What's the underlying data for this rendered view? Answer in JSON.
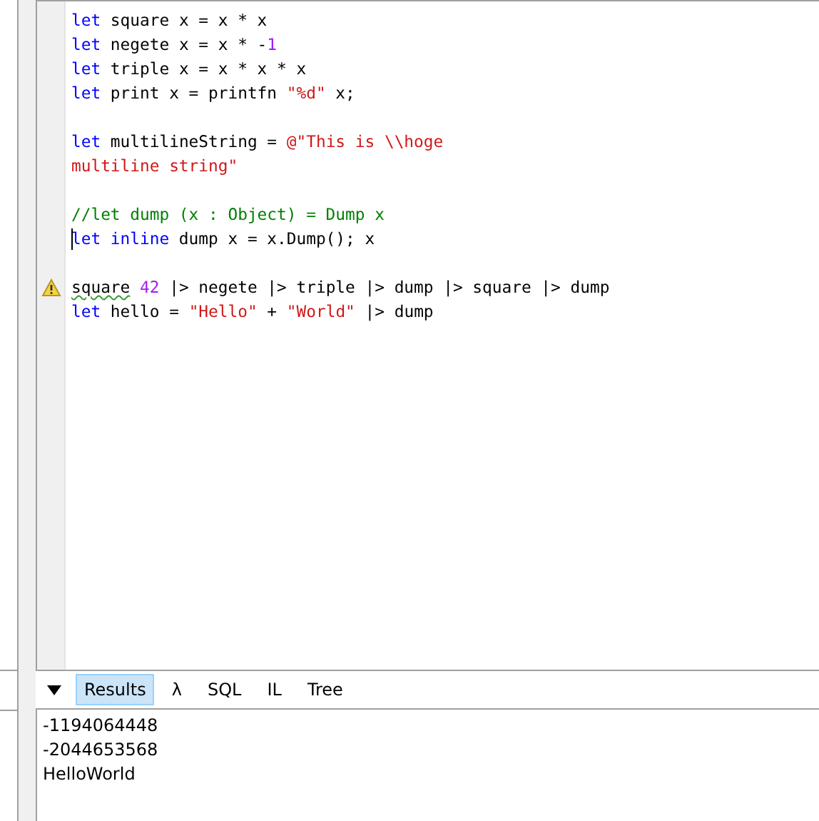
{
  "editor": {
    "lines": [
      {
        "tokens": [
          {
            "kind": "keyword",
            "text": "let"
          },
          {
            "kind": "plain",
            "text": " square x = x * x"
          }
        ]
      },
      {
        "tokens": [
          {
            "kind": "keyword",
            "text": "let"
          },
          {
            "kind": "plain",
            "text": " negete x = x * -"
          },
          {
            "kind": "number",
            "text": "1"
          }
        ]
      },
      {
        "tokens": [
          {
            "kind": "keyword",
            "text": "let"
          },
          {
            "kind": "plain",
            "text": " triple x = x * x * x"
          }
        ]
      },
      {
        "tokens": [
          {
            "kind": "keyword",
            "text": "let"
          },
          {
            "kind": "plain",
            "text": " print x = printfn "
          },
          {
            "kind": "string",
            "text": "\"%d\""
          },
          {
            "kind": "plain",
            "text": " x;"
          }
        ]
      },
      {
        "blank_line_before": true,
        "tokens": [
          {
            "kind": "keyword",
            "text": "let"
          },
          {
            "kind": "plain",
            "text": " multilineString = "
          },
          {
            "kind": "string",
            "text": "@\"This is \\\\hoge"
          }
        ]
      },
      {
        "tokens": [
          {
            "kind": "string",
            "text": "multiline string\""
          }
        ]
      },
      {
        "blank_line_before": true,
        "tokens": [
          {
            "kind": "comment",
            "text": "//let dump (x : Object) = Dump x"
          }
        ]
      },
      {
        "caret": true,
        "tokens": [
          {
            "kind": "keyword",
            "text": "let inline"
          },
          {
            "kind": "plain",
            "text": " dump x = x.Dump(); x"
          }
        ]
      },
      {
        "blank_line_before": true,
        "warning": true,
        "tokens": [
          {
            "kind": "plain",
            "text": "square",
            "squiggle": true
          },
          {
            "kind": "number",
            "text": " 42"
          },
          {
            "kind": "plain",
            "text": " |> negete |> triple |> dump |> square |> dump"
          }
        ]
      },
      {
        "tokens": [
          {
            "kind": "keyword",
            "text": "let"
          },
          {
            "kind": "plain",
            "text": " hello = "
          },
          {
            "kind": "string",
            "text": "\"Hello\""
          },
          {
            "kind": "plain",
            "text": " + "
          },
          {
            "kind": "string",
            "text": "\"World\""
          },
          {
            "kind": "plain",
            "text": " |> dump"
          }
        ]
      }
    ]
  },
  "output_tabs": [
    {
      "label": "Results",
      "selected": true
    },
    {
      "label": "λ",
      "selected": false
    },
    {
      "label": "SQL",
      "selected": false
    },
    {
      "label": "IL",
      "selected": false
    },
    {
      "label": "Tree",
      "selected": false
    }
  ],
  "results": [
    "-1194064448",
    "-2044653568",
    "HelloWorld"
  ]
}
